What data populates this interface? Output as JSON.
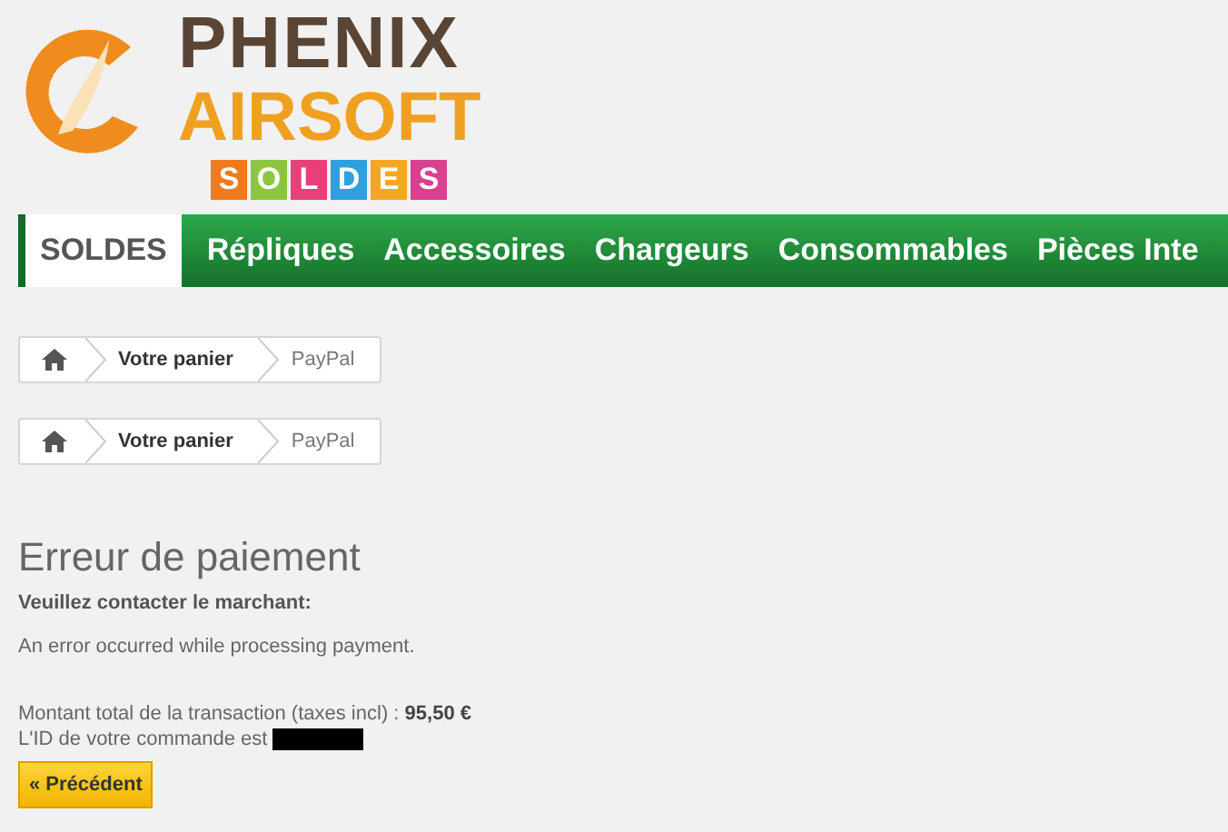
{
  "logo": {
    "line_1": "PHENIX",
    "line_2": "AIRSOFT",
    "tags": [
      {
        "letter": "S",
        "color": "#f07a1e"
      },
      {
        "letter": "O",
        "color": "#8cc63f"
      },
      {
        "letter": "L",
        "color": "#e8407a"
      },
      {
        "letter": "D",
        "color": "#2e9fe0"
      },
      {
        "letter": "E",
        "color": "#f5a623"
      },
      {
        "letter": "S",
        "color": "#d9408f"
      }
    ]
  },
  "menu": [
    {
      "label": "SOLDES",
      "selected": true
    },
    {
      "label": "Répliques",
      "selected": false
    },
    {
      "label": "Accessoires",
      "selected": false
    },
    {
      "label": "Chargeurs",
      "selected": false
    },
    {
      "label": "Consommables",
      "selected": false
    },
    {
      "label": "Pièces Inte",
      "selected": false
    }
  ],
  "breadcrumbs": [
    {
      "items": [
        "Votre panier",
        "PayPal"
      ]
    },
    {
      "items": [
        "Votre panier",
        "PayPal"
      ]
    }
  ],
  "title": "Erreur de paiement",
  "subtitle": "Veuillez contacter le marchant:",
  "error": "An error occurred while processing payment.",
  "total": "Montant total de la transaction (taxes incl) : **95,50 €**",
  "order_id": "L'ID de votre commande est",
  "back_button": "« Précédent"
}
